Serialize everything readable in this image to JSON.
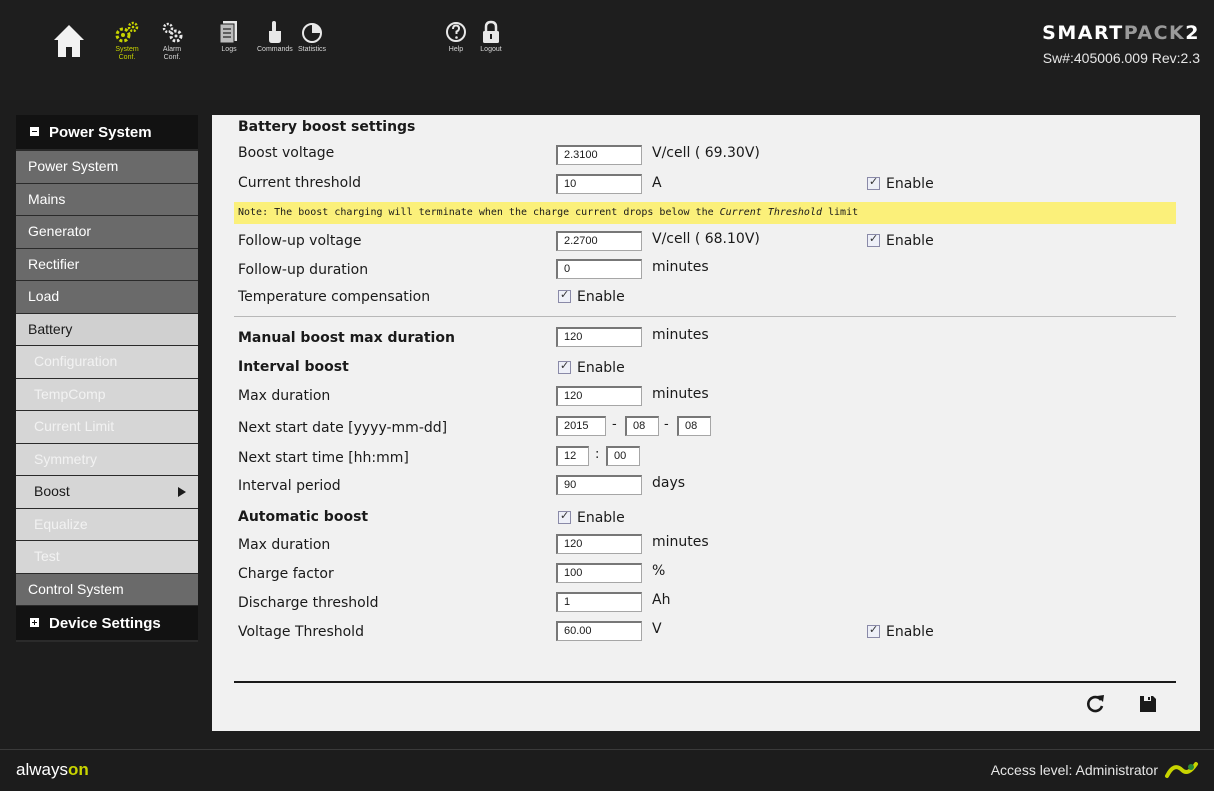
{
  "toolbar": {
    "items": [
      {
        "id": "home",
        "label": "",
        "icon": "home-icon"
      },
      {
        "id": "system_conf",
        "label_line1": "System",
        "label_line2": "Conf.",
        "icon": "gears-icon",
        "active": true
      },
      {
        "id": "alarm_conf",
        "label_line1": "Alarm",
        "label_line2": "Conf.",
        "icon": "alarm-gears-icon"
      },
      {
        "id": "logs",
        "label": "Logs",
        "icon": "logs-icon"
      },
      {
        "id": "commands",
        "label": "Commands",
        "icon": "hand-pointer-icon"
      },
      {
        "id": "statistics",
        "label": "Statistics",
        "icon": "pie-chart-icon"
      },
      {
        "id": "help",
        "label": "Help",
        "icon": "help-icon"
      },
      {
        "id": "logout",
        "label": "Logout",
        "icon": "lock-icon"
      }
    ]
  },
  "brand": {
    "logo_part1": "SMART",
    "logo_part2": "PACK",
    "logo_part3": "2",
    "software": "Sw#:405006.009 Rev:2.3"
  },
  "sidebar": {
    "power_system_header": "Power System",
    "items": [
      {
        "label": "Power System"
      },
      {
        "label": "Mains"
      },
      {
        "label": "Generator"
      },
      {
        "label": "Rectifier"
      },
      {
        "label": "Load"
      },
      {
        "label": "Battery"
      }
    ],
    "battery_sub": [
      {
        "label": "Configuration"
      },
      {
        "label": "TempComp"
      },
      {
        "label": "Current Limit"
      },
      {
        "label": "Symmetry"
      },
      {
        "label": "Boost"
      },
      {
        "label": "Equalize"
      },
      {
        "label": "Test"
      }
    ],
    "control_system": "Control System",
    "device_settings_header": "Device Settings"
  },
  "form": {
    "section_title": "Battery boost settings",
    "boost_voltage": {
      "label": "Boost voltage",
      "value": "2.3100",
      "unit": "V/cell ( 69.30V)"
    },
    "current_threshold": {
      "label": "Current threshold",
      "value": "10",
      "unit": "A",
      "enable": "Enable"
    },
    "note_prefix": "Note: The boost charging will terminate when the charge current drops below the ",
    "note_italic": "Current Threshold",
    "note_suffix": " limit",
    "followup_voltage": {
      "label": "Follow-up voltage",
      "value": "2.2700",
      "unit": "V/cell ( 68.10V)",
      "enable": "Enable"
    },
    "followup_duration": {
      "label": "Follow-up duration",
      "value": "0",
      "unit": "minutes"
    },
    "temp_comp": {
      "label": "Temperature compensation",
      "enable": "Enable"
    },
    "manual_boost": {
      "label": "Manual boost max duration",
      "value": "120",
      "unit": "minutes"
    },
    "interval_boost": {
      "label": "Interval boost",
      "enable": "Enable"
    },
    "interval_max_duration": {
      "label": "Max duration",
      "value": "120",
      "unit": "minutes"
    },
    "next_start_date": {
      "label": "Next start date [yyyy-mm-dd]",
      "year": "2015",
      "month": "08",
      "day": "08",
      "sep": "-"
    },
    "next_start_time": {
      "label": "Next start time [hh:mm]",
      "hour": "12",
      "minute": "00",
      "sep": ":"
    },
    "interval_period": {
      "label": "Interval period",
      "value": "90",
      "unit": "days"
    },
    "automatic_boost": {
      "label": "Automatic boost",
      "enable": "Enable"
    },
    "auto_max_duration": {
      "label": "Max duration",
      "value": "120",
      "unit": "minutes"
    },
    "charge_factor": {
      "label": "Charge factor",
      "value": "100",
      "unit": "%"
    },
    "discharge_threshold": {
      "label": "Discharge threshold",
      "value": "1",
      "unit": "Ah"
    },
    "voltage_threshold": {
      "label": "Voltage Threshold",
      "value": "60.00",
      "unit": "V",
      "enable": "Enable"
    }
  },
  "footer": {
    "always": "always",
    "on": "on",
    "access_level": "Access level: Administrator"
  },
  "colors": {
    "accent": "#c8d400",
    "note_bg": "#fbf07a",
    "panel_bg": "#f1f1f1"
  }
}
